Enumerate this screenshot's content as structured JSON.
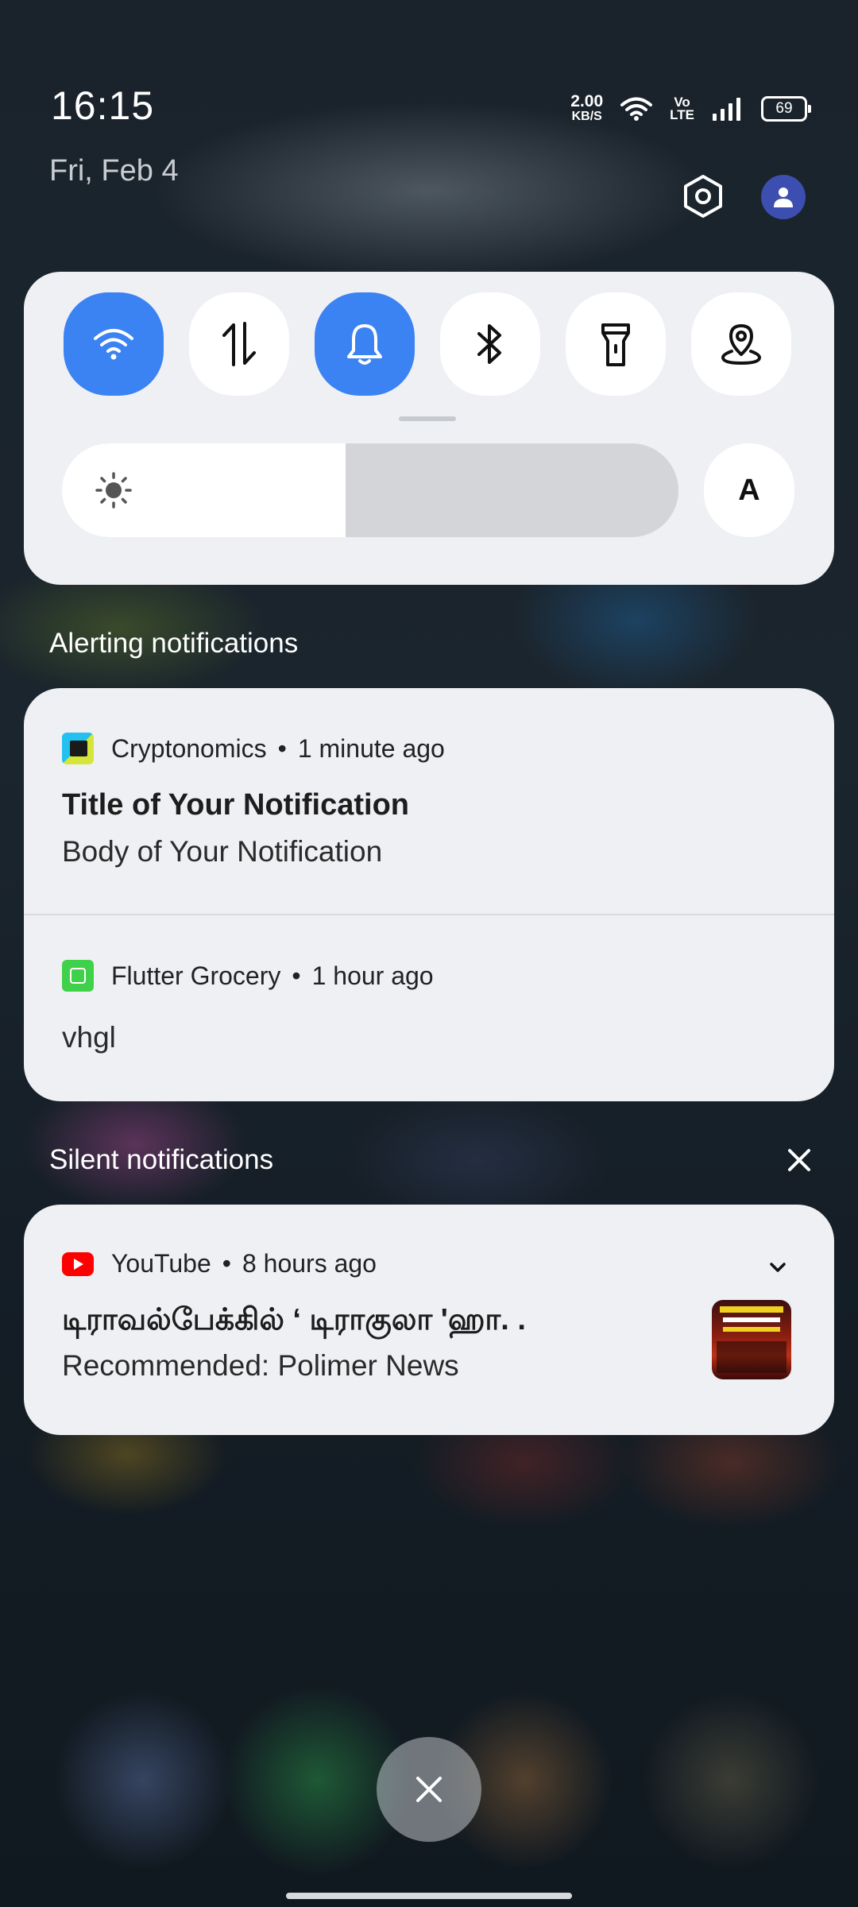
{
  "status_bar": {
    "time": "16:15",
    "date": "Fri, Feb 4",
    "net_speed_value": "2.00",
    "net_speed_unit": "KB/S",
    "volte_top": "Vo",
    "volte_bottom": "LTE",
    "battery": "69"
  },
  "quick_settings": {
    "tiles": [
      {
        "name": "wifi-icon",
        "active": true
      },
      {
        "name": "mobile-data-icon",
        "active": false
      },
      {
        "name": "bell-icon",
        "active": true
      },
      {
        "name": "bluetooth-icon",
        "active": false
      },
      {
        "name": "flashlight-icon",
        "active": false
      },
      {
        "name": "location-icon",
        "active": false
      }
    ],
    "brightness_level": 0.46,
    "auto_brightness_label": "A",
    "accent_color": "#3b82f3"
  },
  "alerting": {
    "section_title": "Alerting notifications",
    "notifications": [
      {
        "app": "Cryptonomics",
        "time": "1 minute ago",
        "title": "Title of Your Notification",
        "body": "Body of Your Notification"
      },
      {
        "app": "Flutter Grocery",
        "time": "1 hour ago",
        "body": "vhgl"
      }
    ]
  },
  "silent": {
    "section_title": "Silent notifications",
    "notifications": [
      {
        "app": "YouTube",
        "time": "8 hours ago",
        "title": "டிராவல்பேக்கில் ‘ டிராகுலா 'ஹா. .",
        "body": "Recommended: Polimer News"
      }
    ]
  },
  "separator": "•"
}
